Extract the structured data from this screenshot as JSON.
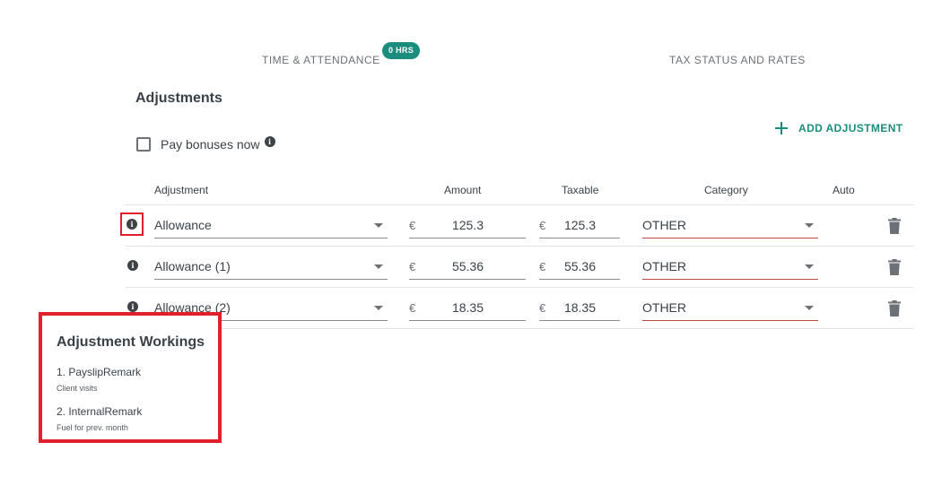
{
  "tabs": {
    "time_attendance": "TIME & ATTENDANCE",
    "time_badge": "0 HRS",
    "tax_status": "TAX STATUS AND RATES"
  },
  "adjustments": {
    "title": "Adjustments",
    "add_button": "ADD ADJUSTMENT",
    "pay_bonuses_label": "Pay bonuses now",
    "pay_bonuses_checked": false,
    "columns": {
      "adjustment": "Adjustment",
      "amount": "Amount",
      "taxable": "Taxable",
      "category": "Category",
      "auto": "Auto"
    },
    "currency_symbol": "€",
    "rows": [
      {
        "adjustment": "Allowance",
        "amount": "125.3",
        "taxable": "125.3",
        "category": "OTHER"
      },
      {
        "adjustment": "Allowance (1)",
        "amount": "55.36",
        "taxable": "55.36",
        "category": "OTHER"
      },
      {
        "adjustment": "Allowance (2)",
        "amount": "18.35",
        "taxable": "18.35",
        "category": "OTHER"
      }
    ]
  },
  "workings": {
    "title": "Adjustment Workings",
    "items": [
      {
        "label": "1. PayslipRemark",
        "detail": "Client visits"
      },
      {
        "label": "2. InternalRemark",
        "detail": "Fuel for prev. month"
      }
    ]
  },
  "colors": {
    "accent": "#1b8d7e",
    "highlight": "#e0202a"
  },
  "icons": {
    "info": "info-icon",
    "trash": "trash-icon",
    "add": "plus-icon",
    "dropdown": "chevron-down-icon"
  }
}
